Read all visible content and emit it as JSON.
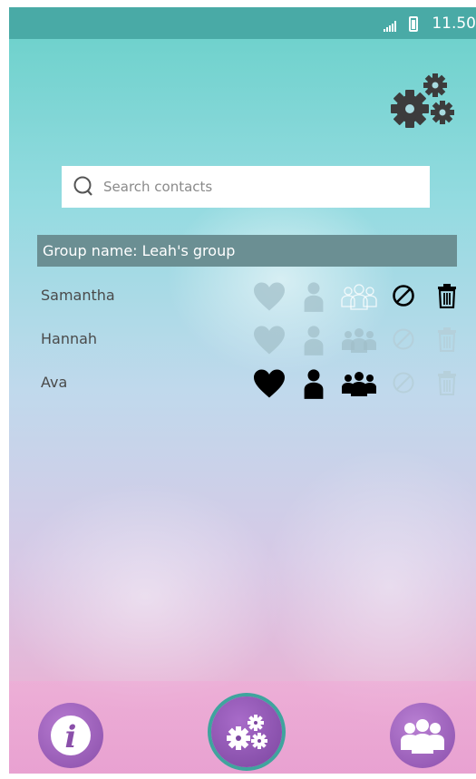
{
  "status_bar": {
    "time": "11.50"
  },
  "search": {
    "placeholder": "Search contacts"
  },
  "group": {
    "name_label": "Group name: Leah's group"
  },
  "contacts": [
    {
      "name": "Samantha",
      "state": "partial"
    },
    {
      "name": "Hannah",
      "state": "faded"
    },
    {
      "name": "Ava",
      "state": "active"
    }
  ],
  "icons": {
    "settings": "gears-icon",
    "search": "search-icon",
    "favorite": "heart-icon",
    "single": "person-icon",
    "group": "group-icon",
    "block": "block-icon",
    "delete": "trash-icon",
    "info": "info-icon"
  },
  "colors": {
    "status_bar": "#49aaa6",
    "group_bar": "#6b8f93",
    "icon_active": "#000000",
    "nav_button": "#8a4faa"
  }
}
